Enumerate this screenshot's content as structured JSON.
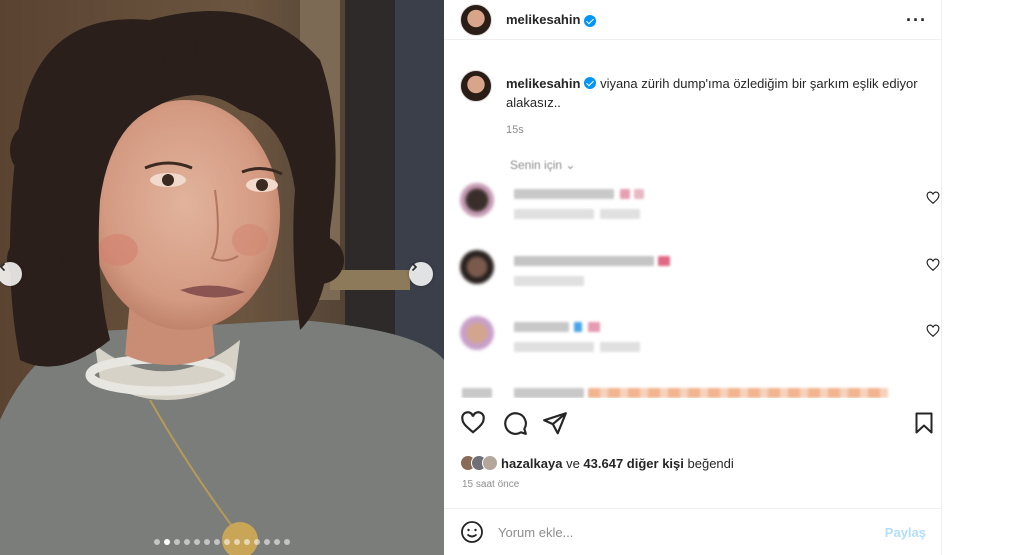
{
  "post": {
    "username": "melikesahin",
    "verified_icon": "verified-badge-icon",
    "more_icon": "more-options-icon"
  },
  "caption": {
    "username": "melikesahin",
    "text": "viyana zürih dump'ıma özlediğim bir şarkım eşlik ediyor alakasız..",
    "time": "15s"
  },
  "comments_section": {
    "filter_label": "Senin için ⌄",
    "comments": [
      {
        "blurred": true
      },
      {
        "blurred": true
      },
      {
        "blurred": true
      },
      {
        "blurred": true
      }
    ]
  },
  "actions": {
    "like_icon": "heart-icon",
    "comment_icon": "comment-icon",
    "share_icon": "send-icon",
    "save_icon": "bookmark-icon"
  },
  "likes": {
    "user": "hazalkaya",
    "connector": "ve",
    "others": "43.647 diğer kişi",
    "suffix": "beğendi"
  },
  "timeago": "15 saat önce",
  "comment_box": {
    "placeholder": "Yorum ekle...",
    "post_label": "Paylaş",
    "emoji_icon": "emoji-icon"
  },
  "carousel": {
    "total_slides": 14,
    "active_slide": 2
  },
  "colors": {
    "accent": "#0095f6",
    "post_disabled": "#b2dffc",
    "muted": "#8e8e8e"
  }
}
